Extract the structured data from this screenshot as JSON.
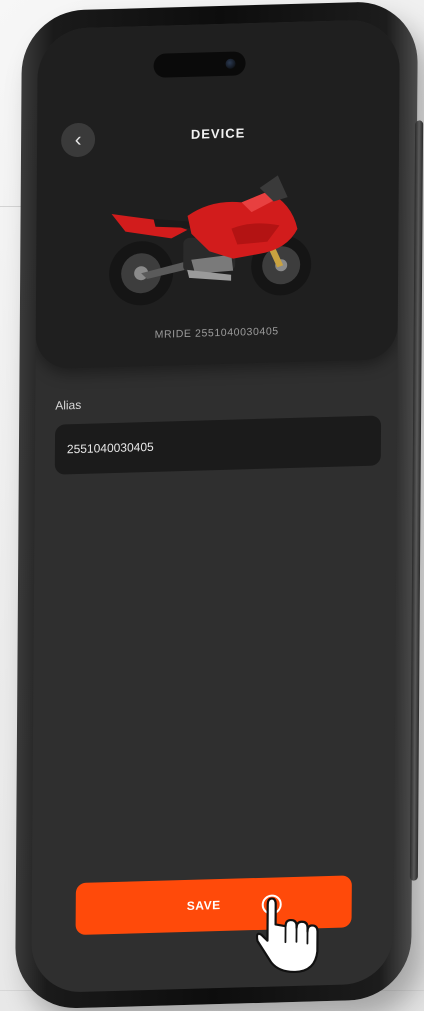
{
  "header": {
    "title": "DEVICE",
    "back_icon": "chevron-left-icon"
  },
  "device": {
    "image": "motorcycle-image",
    "image_color": "#d21c1c",
    "id_text": "MRIDE 2551040030405"
  },
  "form": {
    "alias_label": "Alias",
    "alias_value": "2551040030405"
  },
  "actions": {
    "save_label": "SAVE",
    "accent_color": "#ff4a0a",
    "pointer_icon": "hand-pointer-icon"
  }
}
